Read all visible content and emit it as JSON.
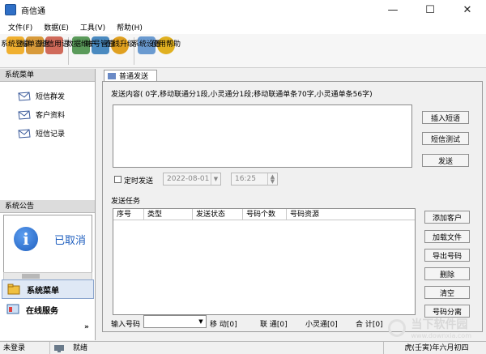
{
  "window": {
    "title": "商信通",
    "minimize": "—",
    "maximize": "☐",
    "close": "✕"
  },
  "menu": [
    "文件(F)",
    "数据(E)",
    "工具(V)",
    "帮助(H)"
  ],
  "toolbar": [
    {
      "label": "系统登录",
      "color": "#f0b030"
    },
    {
      "label": "帐单查询",
      "color": "#d89a3a"
    },
    {
      "label": "短信用语",
      "color": "#d06a5a"
    },
    {
      "label": "数据维护",
      "color": "#5a9a5a"
    },
    {
      "label": "帐号管理",
      "color": "#4a8ac0"
    },
    {
      "label": "在线升级",
      "color": "#e0a020"
    },
    {
      "label": "系统设置",
      "color": "#6a9ad0"
    },
    {
      "label": "使用帮助",
      "color": "#e0b020"
    }
  ],
  "left": {
    "menu_title": "系统菜单",
    "items": [
      "短信群发",
      "客户资料",
      "短信记录"
    ],
    "notice_title": "系统公告",
    "notice_text": "已取消",
    "nav_system": "系统菜单",
    "nav_online": "在线服务",
    "more": "»"
  },
  "tab": "普通发送",
  "send": {
    "content_label": "发送内容( 0字,移动联通分1段,小灵通分1段;移动联通单条70字,小灵通单条56字)",
    "insert_btn": "插入短语",
    "test_btn": "短信测试",
    "send_btn": "发送",
    "timed_label": "定时发送",
    "date": "2022-08-01",
    "time": "16:25"
  },
  "task": {
    "title": "发送任务",
    "columns": [
      "序号",
      "类型",
      "发送状态",
      "号码个数",
      "号码资源"
    ],
    "buttons": [
      "添加客户",
      "加载文件",
      "导出号码",
      "删除",
      "清空",
      "号码分离"
    ]
  },
  "bottom": {
    "input_label": "输入号码",
    "mobile": "移 动[0]",
    "unicom": "联 通[0]",
    "phs": "小灵通[0]",
    "total": "合 计[0]"
  },
  "status": {
    "login": "未登录",
    "ready": "就绪",
    "date": "虎(壬寅)年六月初四"
  },
  "watermark": {
    "big": "当下软件园",
    "small": "www.downxia.com"
  }
}
